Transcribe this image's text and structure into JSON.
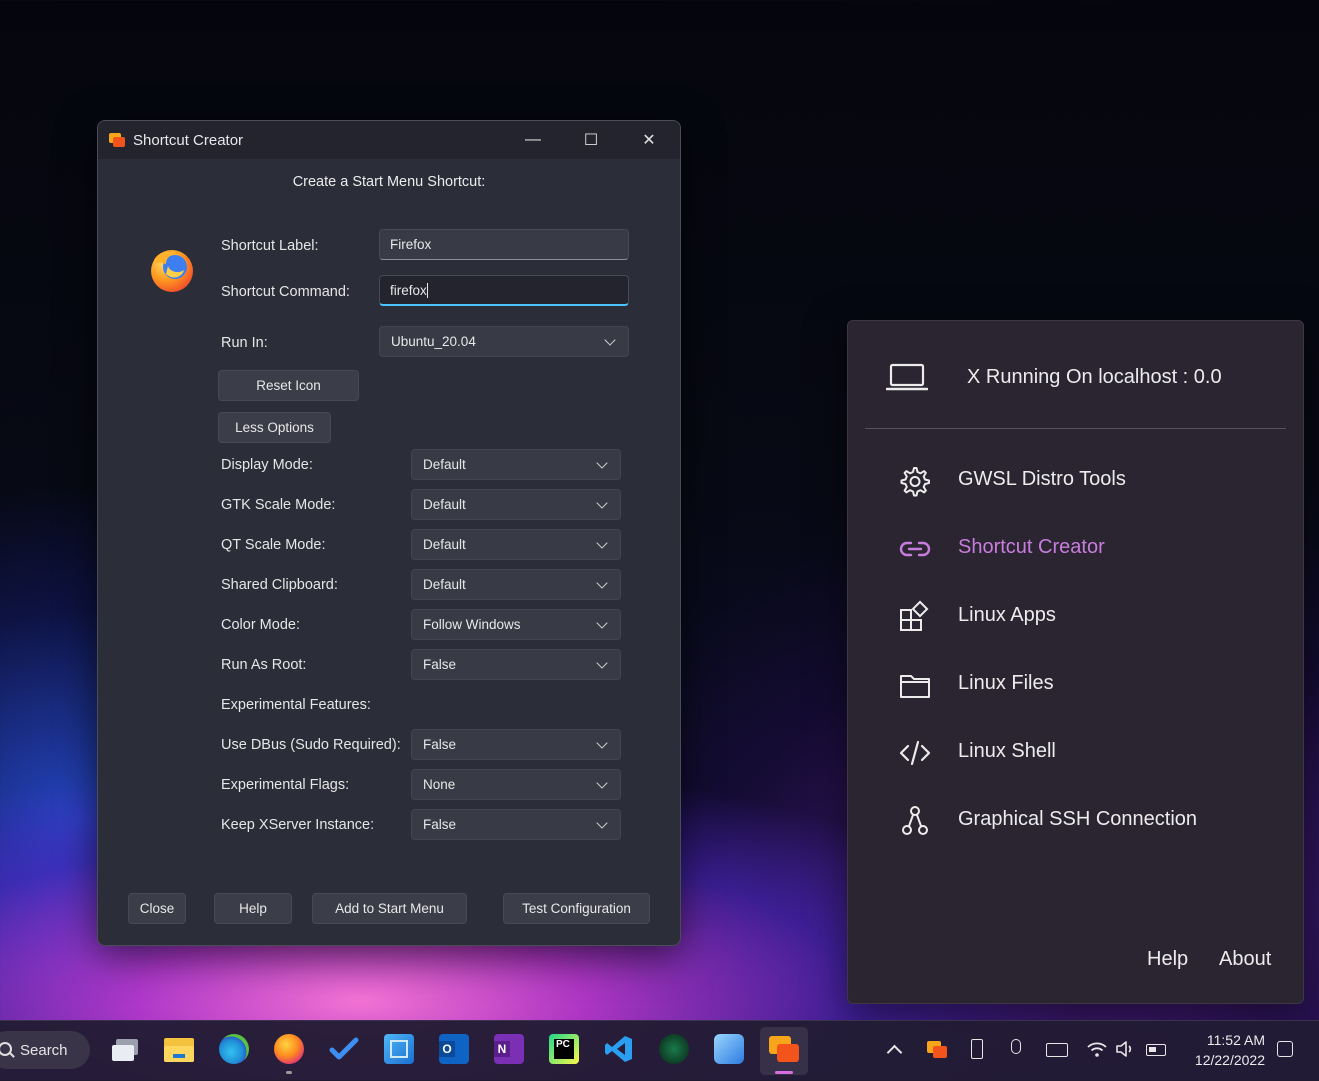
{
  "window": {
    "title": "Shortcut Creator",
    "heading": "Create a Start Menu Shortcut:",
    "controls": {
      "minimize": "—",
      "maximize": "☐",
      "close": "✕"
    },
    "shortcut_label": {
      "label": "Shortcut Label:",
      "value": "Firefox"
    },
    "shortcut_command": {
      "label": "Shortcut Command:",
      "value": "firefox"
    },
    "run_in": {
      "label": "Run In:",
      "value": "Ubuntu_20.04"
    },
    "reset_icon": "Reset Icon",
    "less_options": "Less Options",
    "options": [
      {
        "label": "Display Mode:",
        "value": "Default"
      },
      {
        "label": "GTK Scale Mode:",
        "value": "Default"
      },
      {
        "label": "QT Scale Mode:",
        "value": "Default"
      },
      {
        "label": "Shared Clipboard:",
        "value": "Default"
      },
      {
        "label": "Color Mode:",
        "value": "Follow Windows"
      },
      {
        "label": "Run As Root:",
        "value": "False"
      }
    ],
    "experimental_heading": "Experimental Features:",
    "experimental": [
      {
        "label": "Use DBus (Sudo Required):",
        "value": "False"
      },
      {
        "label": "Experimental Flags:",
        "value": "None"
      },
      {
        "label": "Keep XServer Instance:",
        "value": "False"
      }
    ],
    "buttons": {
      "close": "Close",
      "help": "Help",
      "add": "Add to Start Menu",
      "test": "Test Configuration"
    }
  },
  "panel": {
    "status": "X Running On localhost : 0.0",
    "items": [
      {
        "label": "GWSL Distro Tools",
        "icon": "gear-icon"
      },
      {
        "label": "Shortcut Creator",
        "icon": "link-icon"
      },
      {
        "label": "Linux Apps",
        "icon": "apps-icon"
      },
      {
        "label": "Linux Files",
        "icon": "folder-icon"
      },
      {
        "label": "Linux Shell",
        "icon": "code-icon"
      },
      {
        "label": "Graphical SSH Connection",
        "icon": "network-icon"
      }
    ],
    "help": "Help",
    "about": "About",
    "accent_color": "#c77dde"
  },
  "taskbar": {
    "search": "Search",
    "time": "11:52 AM",
    "date": "12/22/2022"
  }
}
